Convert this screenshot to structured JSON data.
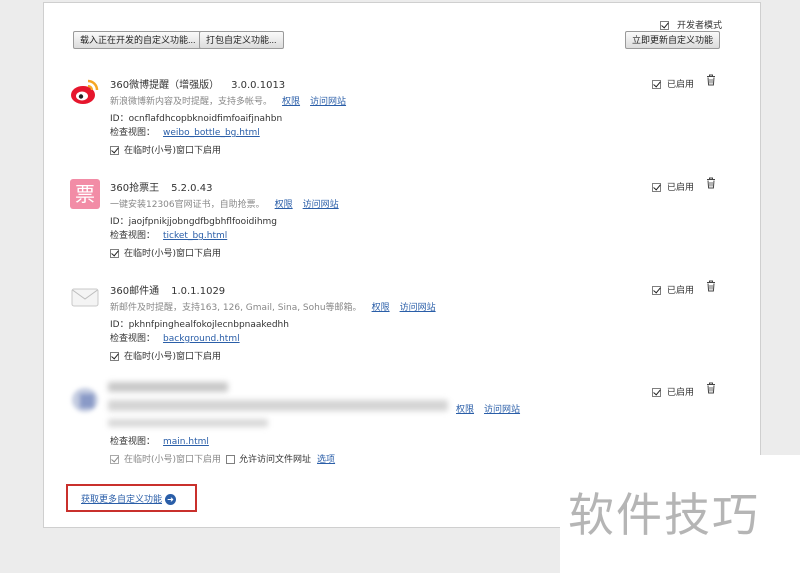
{
  "toolbar": {
    "load_unpacked": "载入正在开发的自定义功能...",
    "pack": "打包自定义功能...",
    "update_now": "立即更新自定义功能",
    "developer_mode": "开发者模式"
  },
  "common": {
    "permissions": "权限",
    "visit_site": "访问网站",
    "id_label": "ID：",
    "inspect_label": "检查视图：",
    "incognito": "在临时(小号)窗口下启用",
    "enabled": "已启用",
    "allow_file_urls": "允许访问文件网址",
    "options": "选项"
  },
  "extensions": [
    {
      "name": "360微博提醒（增强版）",
      "version": "3.0.0.1013",
      "description": "新浪微博新内容及时提醒，支持多帐号。",
      "id": "ocnflafdhcopbknoidfimfoaifjnahbn",
      "view": "weibo_bottle_bg.html",
      "icon": "weibo-icon"
    },
    {
      "name": "360抢票王",
      "version": "5.2.0.43",
      "description": "一键安装12306官网证书，自助抢票。",
      "id": "jaojfpnikjjobngdfbgbhflfooidihmg",
      "view": "ticket_bg.html",
      "icon": "ticket-icon",
      "icon_glyph": "票"
    },
    {
      "name": "360邮件通",
      "version": "1.0.1.1029",
      "description": "新邮件及时提醒，支持163, 126, Gmail, Sina, Sohu等邮箱。",
      "id": "pkhnfpinghealfokojlecnbpnaakedhh",
      "view": "background.html",
      "icon": "mail-icon"
    },
    {
      "view": "main.html",
      "icon": "blurred-extension-icon"
    }
  ],
  "footer": {
    "get_more": "获取更多自定义功能"
  },
  "watermark": "软件技巧",
  "colors": {
    "link": "#2a5ea8",
    "highlight_border": "#c9302c"
  }
}
